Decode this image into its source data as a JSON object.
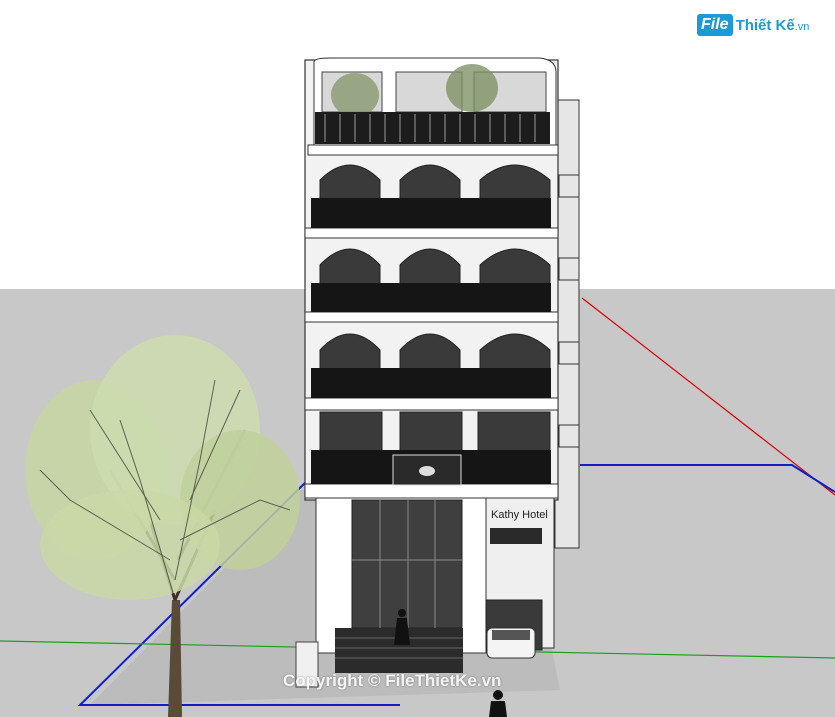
{
  "logo": {
    "prefix": "File",
    "name": "Thiết Kế",
    "domain": ".vn"
  },
  "building": {
    "sign": "Kathy Hotel"
  },
  "watermark": {
    "text": "Copyright © FileThietKe.vn"
  },
  "colors": {
    "sky": "#ffffff",
    "ground": "#c8c8c8",
    "facade": "#f2f2f2",
    "glass": "#3a3a3a",
    "foliage": "#c9d9a8",
    "axis_red": "#e00000",
    "axis_blue": "#1020c8",
    "axis_green": "#1aa01a"
  }
}
